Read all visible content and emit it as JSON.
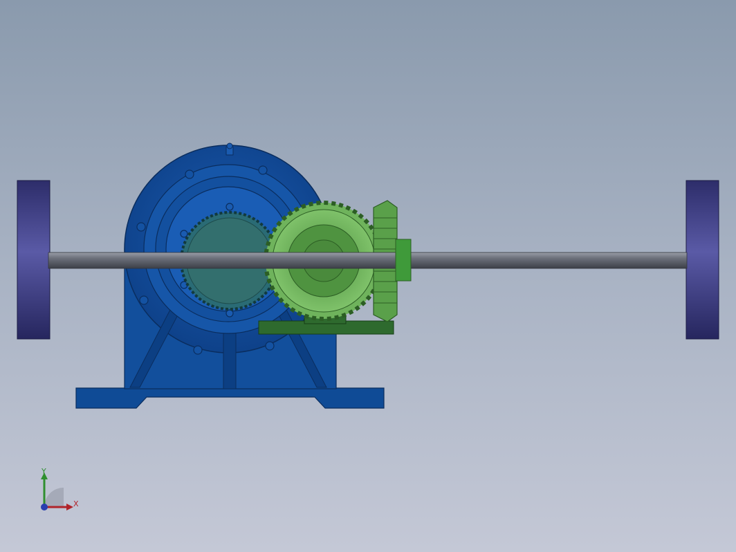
{
  "viewport": {
    "background_top": "#8a9aad",
    "background_bottom": "#c4c8d6"
  },
  "model": {
    "parts": [
      {
        "name": "left-wheel",
        "color": "#3f3f8a"
      },
      {
        "name": "right-wheel",
        "color": "#3f3f8a"
      },
      {
        "name": "axle",
        "color": "#5b5f6b"
      },
      {
        "name": "gearbox-housing",
        "color": "#0f4b96"
      },
      {
        "name": "internal-gear",
        "color": "#2f6f70"
      },
      {
        "name": "bevel-gear",
        "color": "#5aa04a"
      },
      {
        "name": "pinion-gear",
        "color": "#4f9844"
      },
      {
        "name": "gear-mount",
        "color": "#2e6a2e"
      }
    ]
  },
  "triad": {
    "x_label": "X",
    "y_label": "Y",
    "x_color": "#b0232a",
    "y_color": "#2f8f2f",
    "z_color": "#2a3fb0"
  }
}
